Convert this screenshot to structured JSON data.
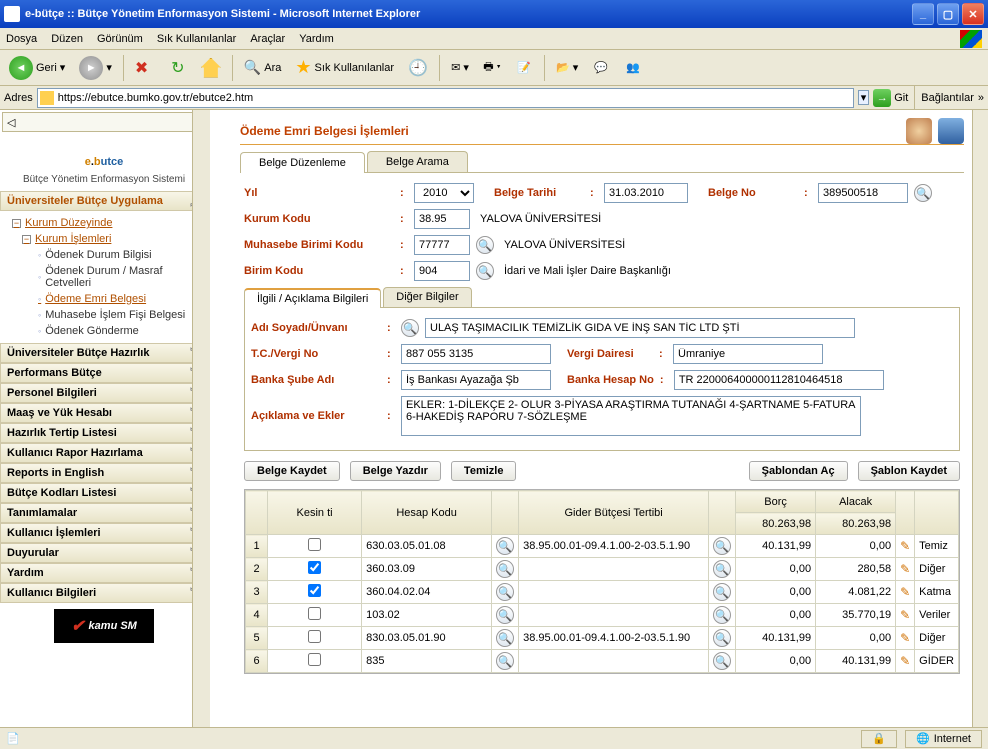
{
  "window": {
    "title": "e-bütçe :: Bütçe Yönetim Enformasyon Sistemi - Microsoft Internet Explorer"
  },
  "menu": [
    "Dosya",
    "Düzen",
    "Görünüm",
    "Sık Kullanılanlar",
    "Araçlar",
    "Yardım"
  ],
  "toolbar": {
    "back": "Geri",
    "search": "Ara",
    "fav": "Sık Kullanılanlar"
  },
  "address": {
    "label": "Adres",
    "url": "https://ebutce.bumko.gov.tr/ebutce2.htm",
    "go": "Git",
    "links": "Bağlantılar"
  },
  "logo": {
    "brand_e": "e",
    "brand_b": "b",
    "brand_rest": "utce",
    "sub": "Bütçe Yönetim Enformasyon Sistemi"
  },
  "sidebar": {
    "acc0": "Üniversiteler Bütçe Uygulama",
    "tree": {
      "n0": "Kurum Düzeyinde",
      "n1": "Kurum İşlemleri",
      "n2": "Ödenek Durum Bilgisi",
      "n3": "Ödenek Durum / Masraf Cetvelleri",
      "n4": "Ödeme Emri Belgesi",
      "n5": "Muhasebe İşlem Fişi Belgesi",
      "n6": "Ödenek Gönderme"
    },
    "acc": [
      "Üniversiteler Bütçe Hazırlık",
      "Performans Bütçe",
      "Personel Bilgileri",
      "Maaş ve Yük Hesabı",
      "Hazırlık Tertip Listesi",
      "Kullanıcı Rapor Hazırlama",
      "Reports in English",
      "Bütçe Kodları Listesi",
      "Tanımlamalar",
      "Kullanıcı İşlemleri",
      "Duyurular",
      "Yardım",
      "Kullanıcı Bilgileri"
    ],
    "kamu": "kamu SM"
  },
  "page": {
    "title": "Ödeme Emri Belgesi İşlemleri",
    "tabs": [
      "Belge Düzenleme",
      "Belge Arama"
    ],
    "form": {
      "yil_l": "Yıl",
      "yil_v": "2010",
      "tarih_l": "Belge Tarihi",
      "tarih_v": "31.03.2010",
      "no_l": "Belge No",
      "no_v": "389500518",
      "kurum_l": "Kurum Kodu",
      "kurum_v": "38.95",
      "kurum_t": "YALOVA ÜNİVERSİTESİ",
      "muh_l": "Muhasebe Birimi Kodu",
      "muh_v": "77777",
      "muh_t": "YALOVA ÜNİVERSİTESİ",
      "birim_l": "Birim Kodu",
      "birim_v": "904",
      "birim_t": "İdari ve Mali İşler Daire Başkanlığı"
    },
    "subtabs": [
      "İlgili / Açıklama Bilgileri",
      "Diğer Bilgiler"
    ],
    "detail": {
      "ad_l": "Adı Soyadı/Ünvanı",
      "ad_v": "ULAŞ TAŞIMACILIK TEMİZLİK GIDA VE İNŞ SAN TİC LTD ŞTİ",
      "tc_l": "T.C./Vergi No",
      "tc_v": "887 055 3135",
      "vd_l": "Vergi Dairesi",
      "vd_v": "Ümraniye",
      "bs_l": "Banka Şube Adı",
      "bs_v": "İş Bankası Ayazağa Şb",
      "bh_l": "Banka Hesap No",
      "bh_v": "TR 220006400000112810464518",
      "ek_l": "Açıklama ve Ekler",
      "ek_v": "EKLER: 1-DİLEKÇE 2- OLUR 3-PİYASA ARAŞTIRMA TUTANAĞI 4-ŞARTNAME 5-FATURA 6-HAKEDİŞ RAPORU 7-SÖZLEŞME"
    },
    "buttons": {
      "kaydet": "Belge Kaydet",
      "yazdir": "Belge Yazdır",
      "temizle": "Temizle",
      "sablon_ac": "Şablondan Aç",
      "sablon_k": "Şablon Kaydet"
    },
    "grid": {
      "head": {
        "kesinti": "Kesin ti",
        "hesap": "Hesap Kodu",
        "gider": "Gider Bütçesi Tertibi",
        "borc": "Borç",
        "alacak": "Alacak"
      },
      "sum": {
        "borc": "80.263,98",
        "alacak": "80.263,98"
      },
      "rows": [
        {
          "n": "1",
          "ck": false,
          "hesap": "630.03.05.01.08",
          "gider": "38.95.00.01-09.4.1.00-2-03.5.1.90",
          "borc": "40.131,99",
          "alacak": "0,00",
          "desc": "Temiz"
        },
        {
          "n": "2",
          "ck": true,
          "hesap": "360.03.09",
          "gider": "",
          "borc": "0,00",
          "alacak": "280,58",
          "desc": "Diğer"
        },
        {
          "n": "3",
          "ck": true,
          "hesap": "360.04.02.04",
          "gider": "",
          "borc": "0,00",
          "alacak": "4.081,22",
          "desc": "Katma"
        },
        {
          "n": "4",
          "ck": false,
          "hesap": "103.02",
          "gider": "",
          "borc": "0,00",
          "alacak": "35.770,19",
          "desc": "Veriler"
        },
        {
          "n": "5",
          "ck": false,
          "hesap": "830.03.05.01.90",
          "gider": "38.95.00.01-09.4.1.00-2-03.5.1.90",
          "borc": "40.131,99",
          "alacak": "0,00",
          "desc": "Diğer"
        },
        {
          "n": "6",
          "ck": false,
          "hesap": "835",
          "gider": "",
          "borc": "0,00",
          "alacak": "40.131,99",
          "desc": "GİDER"
        }
      ]
    }
  },
  "status": {
    "internet": "Internet"
  }
}
